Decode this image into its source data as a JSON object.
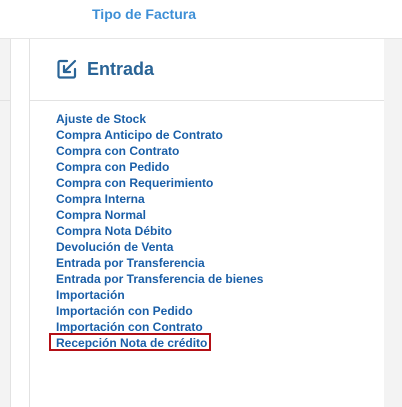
{
  "top": {
    "link_label": "Tipo de Factura"
  },
  "panel": {
    "title": "Entrada",
    "icon": "edit-box-icon",
    "items": [
      {
        "label": "Ajuste de Stock"
      },
      {
        "label": "Compra Anticipo de Contrato"
      },
      {
        "label": "Compra con Contrato"
      },
      {
        "label": "Compra con Pedido"
      },
      {
        "label": "Compra con Requerimiento"
      },
      {
        "label": "Compra Interna"
      },
      {
        "label": "Compra Normal"
      },
      {
        "label": "Compra Nota Débito"
      },
      {
        "label": "Devolución de Venta"
      },
      {
        "label": "Entrada por Transferencia"
      },
      {
        "label": "Entrada por Transferencia de bienes"
      },
      {
        "label": "Importación"
      },
      {
        "label": "Importación con Pedido"
      },
      {
        "label": "Importación con Contrato"
      },
      {
        "label": "Recepción Nota de crédito"
      }
    ],
    "highlighted_item": "Recepción Nota de crédito"
  },
  "colors": {
    "link": "#1a5fa8",
    "title": "#2a6496",
    "top_link": "#3d8fd6",
    "highlight_border": "#b30f16"
  }
}
